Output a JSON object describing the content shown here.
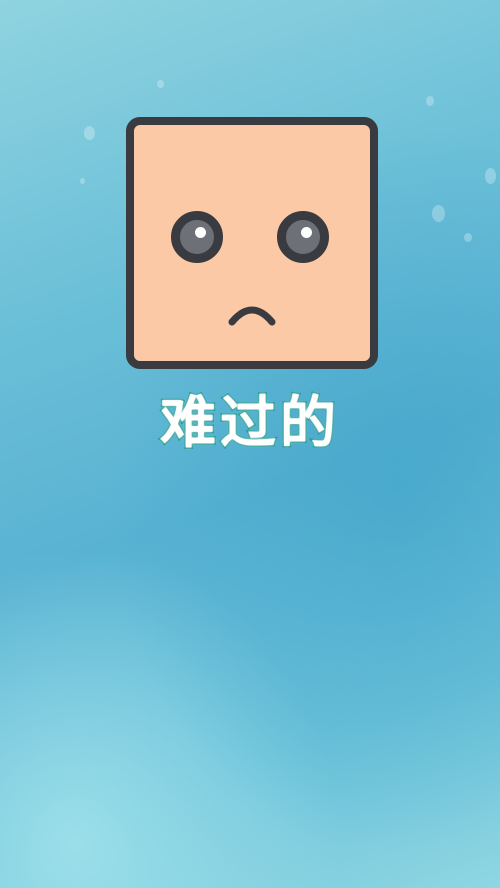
{
  "caption": {
    "text": "难过的",
    "fill_color": "#ffffff",
    "outline_color": "#1f9a8f"
  },
  "face": {
    "expression": "sad",
    "skin_color": "#fbc9a6",
    "outline_color": "#3a3b40",
    "eye_color": "#6d7077"
  },
  "background": {
    "colors": [
      "#8fd3e0",
      "#58b2d2",
      "#6cc3da"
    ],
    "decoration": "bubbles"
  },
  "icons": {
    "face": "sad-square-face-icon",
    "mouth": "frown-mouth-icon",
    "eye": "eye-icon"
  }
}
